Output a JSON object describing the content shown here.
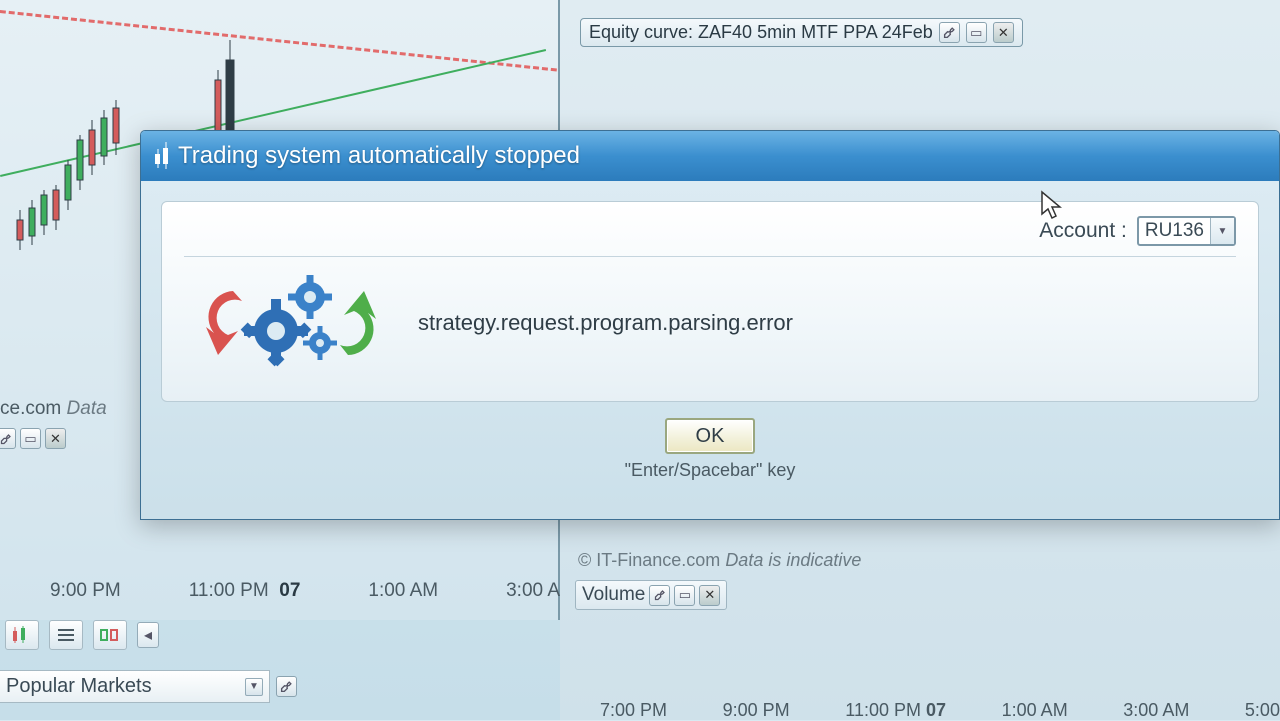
{
  "equity_tab": {
    "label": "Equity curve: ZAF40 5min MTF PPA 24Feb"
  },
  "watermark_left": {
    "suffix": "ce.com",
    "data": " Data"
  },
  "watermark_right": {
    "copy": "© IT-Finance.com ",
    "data": "Data is indicative"
  },
  "volume_panel": {
    "label": "Volume"
  },
  "left_axis": {
    "t1": "9:00 PM",
    "t2": "11:00 PM",
    "day": "07",
    "t3": "1:00 AM",
    "t4": "3:00 A"
  },
  "right_axis": {
    "t1": "7:00 PM",
    "t2": "9:00 PM",
    "t3": "11:00 PM",
    "day": "07",
    "t4": "1:00 AM",
    "t5": "3:00 AM",
    "t6": "5:00"
  },
  "markets": {
    "label": "Popular Markets"
  },
  "dialog": {
    "title": "Trading system automatically stopped",
    "account_label": "Account :",
    "account_value": "RU136",
    "message": "strategy.request.program.parsing.error",
    "ok_label": "OK",
    "ok_hint": "\"Enter/Spacebar\" key"
  }
}
